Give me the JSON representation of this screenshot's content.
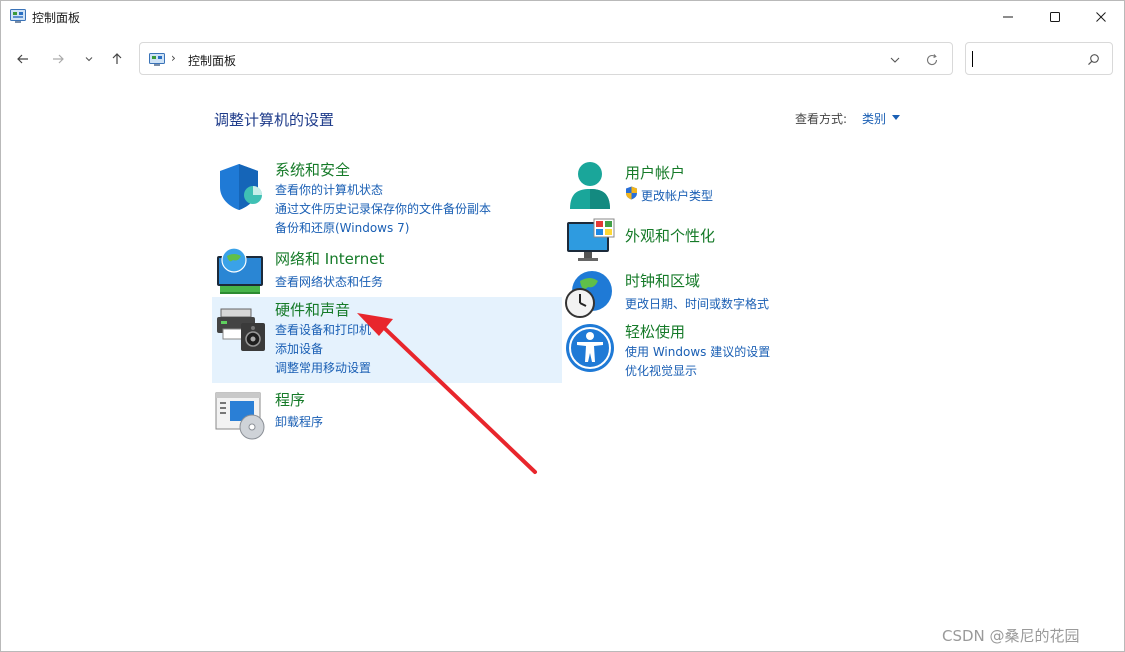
{
  "window": {
    "title": "控制面板"
  },
  "address": {
    "separator": "›",
    "path": "控制面板"
  },
  "search": {
    "placeholder": ""
  },
  "main": {
    "page_title": "调整计算机的设置",
    "view_label": "查看方式:",
    "view_value": "类别"
  },
  "categories": {
    "system_security": {
      "title": "系统和安全",
      "links": [
        "查看你的计算机状态",
        "通过文件历史记录保存你的文件备份副本",
        "备份和还原(Windows 7)"
      ]
    },
    "network": {
      "title": "网络和 Internet",
      "links": [
        "查看网络状态和任务"
      ]
    },
    "hardware_sound": {
      "title": "硬件和声音",
      "links": [
        "查看设备和打印机",
        "添加设备",
        "调整常用移动设置"
      ]
    },
    "programs": {
      "title": "程序",
      "links": [
        "卸载程序"
      ]
    },
    "user_accounts": {
      "title": "用户帐户",
      "links": [
        "更改帐户类型"
      ]
    },
    "appearance": {
      "title": "外观和个性化",
      "links": []
    },
    "clock_region": {
      "title": "时钟和区域",
      "links": [
        "更改日期、时间或数字格式"
      ]
    },
    "ease_of_access": {
      "title": "轻松使用",
      "links": [
        "使用 Windows 建议的设置",
        "优化视觉显示"
      ]
    }
  },
  "watermark": "CSDN @桑尼的花园",
  "colors": {
    "title_green": "#157a28",
    "link_blue": "#1a5fb4",
    "heading_blue": "#1e3b8a",
    "hover_bg": "#e5f2fd",
    "arrow_red": "#e8262c"
  },
  "icons": {
    "title": "control-panel-icon",
    "back": "arrow-left-icon",
    "forward": "arrow-right-icon",
    "recent": "chevron-down-icon",
    "up": "arrow-up-icon",
    "refresh": "refresh-icon",
    "search": "search-icon",
    "system_security": "shield-icon",
    "network": "network-globe-icon",
    "hardware_sound": "printer-speaker-icon",
    "programs": "programs-disc-icon",
    "user_accounts": "user-icon",
    "appearance": "monitor-palette-icon",
    "clock_region": "clock-globe-icon",
    "ease_of_access": "accessibility-icon",
    "uac": "uac-shield-icon"
  }
}
